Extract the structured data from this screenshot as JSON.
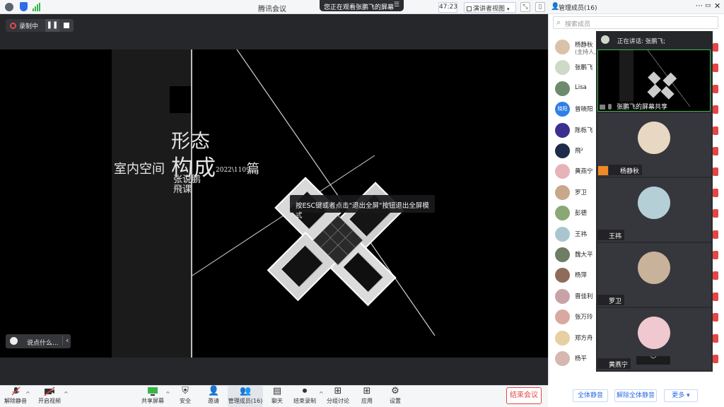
{
  "titlebar": {
    "app_title": "腾讯会议",
    "watching": "您正在观看张鹏飞的屏幕",
    "timer": "47:23",
    "view_mode": "演讲者视图"
  },
  "recording": {
    "label": "录制中"
  },
  "slide": {
    "title_line1": "形态",
    "title_line2": "构成",
    "prefix": "室内空间",
    "date": "2022\\1109",
    "suffix": "篇",
    "author": "张说鹏飛课"
  },
  "toast": "按ESC键或者点击\"退出全屏\"按钮退出全屏模式",
  "chat": {
    "placeholder": "说点什么..."
  },
  "toolbar": {
    "unmute": "解除静音",
    "video": "开启视频",
    "share": "共享屏幕",
    "security": "安全",
    "invite": "邀请",
    "members": "管理成员(16)",
    "chat": "聊天",
    "end_record": "结束录制",
    "breakout": "分组讨论",
    "apps": "应用",
    "settings": "设置",
    "end_meeting": "结束会议"
  },
  "panel": {
    "title": "管理成员(16)",
    "search_placeholder": "搜索成员",
    "speaking": "正在讲话: 张鹏飞;",
    "members": [
      {
        "name": "杨静秋",
        "sub": "(主持人,",
        "color": "#d9c2a8"
      },
      {
        "name": "张鹏飞",
        "sub": "",
        "color": "#cfd9c7"
      },
      {
        "name": "Lisa",
        "sub": "",
        "color": "#6d8b6a"
      },
      {
        "name": "曾晓阳",
        "sub": "",
        "color": "#2f7ee8",
        "badge": "晓阳"
      },
      {
        "name": "陈栎飞",
        "sub": "",
        "color": "#3b2f8f"
      },
      {
        "name": "飛²",
        "sub": "",
        "color": "#1e2c4a"
      },
      {
        "name": "黄燕宁",
        "sub": "",
        "color": "#e7b3b8"
      },
      {
        "name": "罗卫",
        "sub": "",
        "color": "#c9a78a"
      },
      {
        "name": "彭德",
        "sub": "",
        "color": "#8aa874"
      },
      {
        "name": "王祎",
        "sub": "",
        "color": "#a9c6cf"
      },
      {
        "name": "魏大平",
        "sub": "",
        "color": "#6e7d63"
      },
      {
        "name": "杨萍",
        "sub": "",
        "color": "#8f6b5a"
      },
      {
        "name": "晋佳利",
        "sub": "",
        "color": "#c7a3a8"
      },
      {
        "name": "张万玲",
        "sub": "",
        "color": "#d8a9a0"
      },
      {
        "name": "郑方舟",
        "sub": "",
        "color": "#e6cfa1"
      },
      {
        "name": "杨平",
        "sub": "",
        "color": "#d6b8b0"
      }
    ],
    "tiles": {
      "share": "张鹏飞的屏幕共享",
      "t1": "杨静秋",
      "t2": "王祎",
      "t3": "罗卫",
      "t4": "黄燕宁"
    },
    "footer": {
      "mute_all": "全体静音",
      "unmute_all": "解除全体静音",
      "more": "更多"
    }
  },
  "colors": {
    "accent": "#2b6ee6",
    "danger": "#e64545",
    "active_speaker": "#3ab54a"
  }
}
